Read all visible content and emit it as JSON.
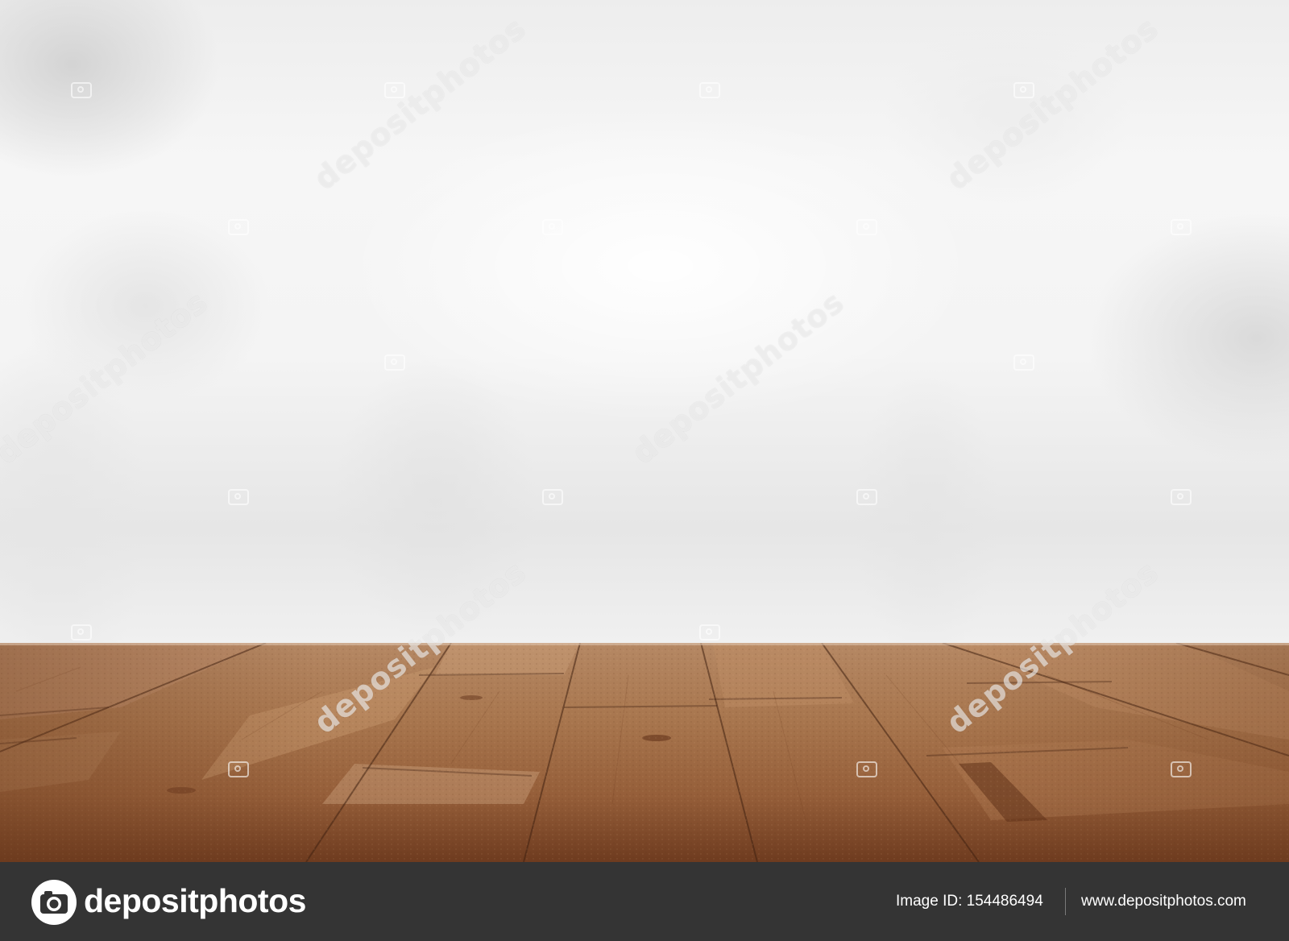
{
  "watermark": {
    "text": "depositphotos"
  },
  "footer": {
    "brand_name": "depositphotos",
    "image_id_label": "Image ID:",
    "image_id_value": "154486494",
    "site_url": "www.depositphotos.com",
    "background_color": "#343434",
    "text_color": "#ffffff"
  },
  "icons": {
    "brand_logo": "camera-logo-icon",
    "watermark_mark": "camera-icon"
  },
  "colors": {
    "backdrop": "#f2f2f2",
    "wood_light": "#b3835e",
    "wood_dark": "#7a4527"
  }
}
